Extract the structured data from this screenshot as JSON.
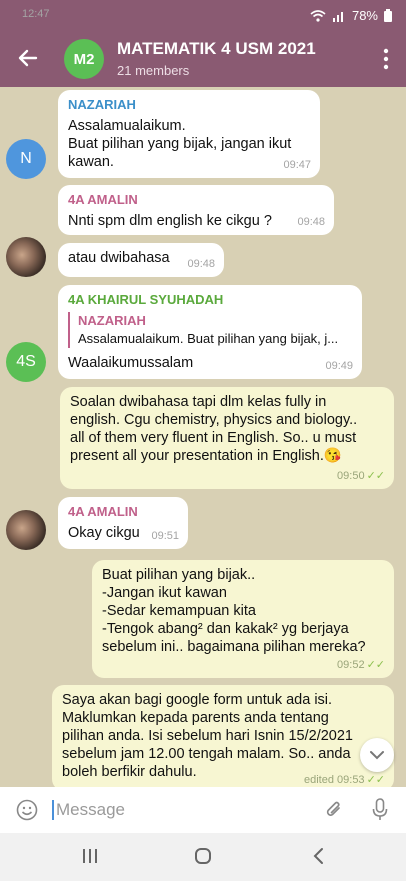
{
  "status": {
    "time": "12:47",
    "battery": "78%"
  },
  "header": {
    "avatar_initials": "M2",
    "title": "MATEMATIK 4 USM 2021",
    "subtitle": "21 members"
  },
  "messages": [
    {
      "sender": "NAZARIAH",
      "text": [
        "Assalamualaikum.",
        "Buat pilihan yang bijak, jangan ikut",
        "kawan."
      ],
      "time": "09:47",
      "avatar": "N"
    },
    {
      "sender": "4A AMALIN",
      "text": [
        "Nnti spm dlm english ke cikgu ?"
      ],
      "time": "09:48"
    },
    {
      "text": [
        "atau dwibahasa"
      ],
      "time": "09:48"
    },
    {
      "sender": "4A KHAIRUL SYUHADAH",
      "reply_name": "NAZARIAH",
      "reply_text": "Assalamualaikum. Buat pilihan yang bijak, j...",
      "text": [
        "Waalaikumussalam"
      ],
      "time": "09:49",
      "avatar": "4S"
    },
    {
      "text": [
        "Soalan dwibahasa tapi dlm kelas fully in",
        "english. Cgu chemistry, physics and biology..",
        "all of them very fluent in English. So.. u must",
        "present all your presentation in English.😘"
      ],
      "time": "09:50"
    },
    {
      "sender": "4A AMALIN",
      "text": [
        "Okay cikgu"
      ],
      "time": "09:51"
    },
    {
      "text": [
        "Buat pilihan yang bijak..",
        "-Jangan ikut kawan",
        "-Sedar kemampuan kita",
        "-Tengok abang² dan kakak² yg berjaya",
        "sebelum ini.. bagaimana pilihan mereka?"
      ],
      "time": "09:52"
    },
    {
      "text": [
        "Saya akan bagi google form untuk ada isi.",
        "Maklumkan kepada parents anda tentang",
        "pilihan anda. Isi sebelum hari Isnin 15/2/2021",
        "sebelum jam 12.00 tengah malam. So.. anda",
        "boleh berfikir dahulu."
      ],
      "time": "edited 09:53"
    }
  ],
  "input": {
    "placeholder": "Message"
  },
  "colors": {
    "header": "#8a5a72",
    "chat_bg": "#d8d0b4",
    "outgoing": "#f7f6d2",
    "accent_green": "#5bbf55",
    "accent_blue": "#4a90d9"
  }
}
